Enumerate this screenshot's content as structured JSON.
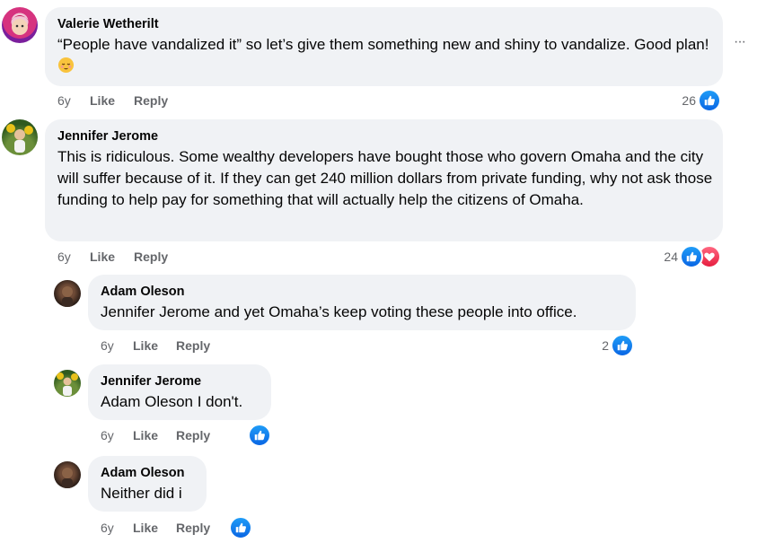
{
  "comments": [
    {
      "author": "Valerie Wetherilt",
      "text": "“People have vandalized it” so let’s give them something new and shiny to vandalize. Good plan!",
      "emoji": "relieved-face-emoji",
      "time": "6y",
      "like_label": "Like",
      "reply_label": "Reply",
      "reaction_count": "26",
      "reactions": [
        "like-icon"
      ],
      "more_label": "···"
    },
    {
      "author": "Jennifer Jerome",
      "text": "This is ridiculous. Some wealthy developers have bought those who govern Omaha and the city will suffer because of it. If they can get 240 million dollars from private funding, why not ask those funding to help pay for something that will actually help the citizens of Omaha.",
      "time": "6y",
      "like_label": "Like",
      "reply_label": "Reply",
      "reaction_count": "24",
      "reactions": [
        "like-icon",
        "love-icon"
      ],
      "replies": [
        {
          "author": "Adam Oleson",
          "text": "Jennifer Jerome and yet Omaha’s keep voting these people into office.",
          "time": "6y",
          "like_label": "Like",
          "reply_label": "Reply",
          "reaction_count": "2",
          "reactions": [
            "like-icon"
          ]
        },
        {
          "author": "Jennifer Jerome",
          "text": "Adam Oleson I don't.",
          "time": "6y",
          "like_label": "Like",
          "reply_label": "Reply",
          "reaction_count": "",
          "reactions": [
            "like-icon"
          ]
        },
        {
          "author": "Adam Oleson",
          "text": "Neither did i",
          "time": "6y",
          "like_label": "Like",
          "reply_label": "Reply",
          "reaction_count": "",
          "reactions": [
            "like-icon"
          ]
        }
      ]
    }
  ],
  "colors": {
    "bubble": "#f0f2f5",
    "secondary_text": "#65676b",
    "like_blue": "#0a66e4",
    "love_red": "#e61e3f"
  }
}
